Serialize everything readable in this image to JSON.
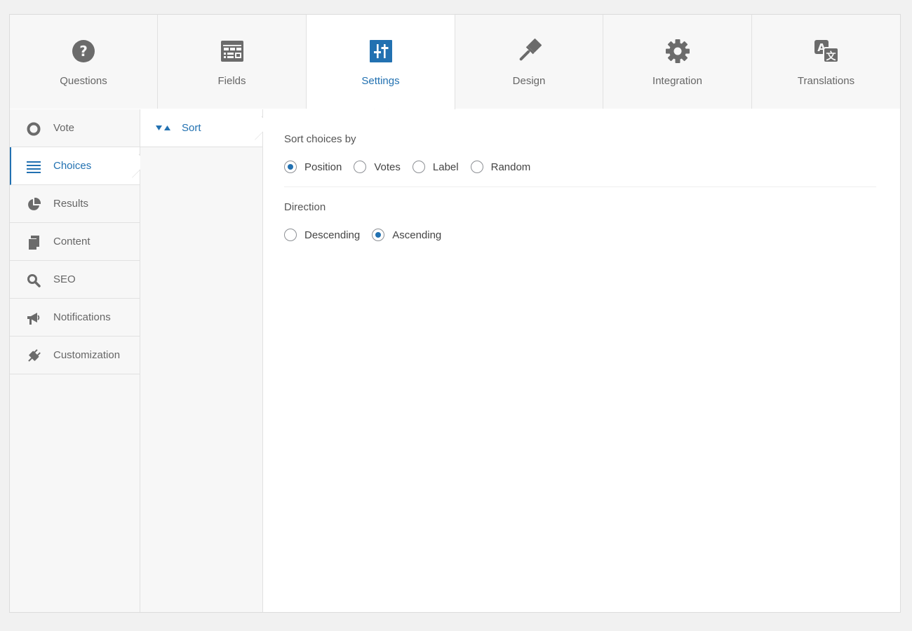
{
  "tabs": [
    {
      "label": "Questions",
      "icon": "question-circle-icon"
    },
    {
      "label": "Fields",
      "icon": "form-fields-icon"
    },
    {
      "label": "Settings",
      "icon": "sliders-icon"
    },
    {
      "label": "Design",
      "icon": "paintbrush-icon"
    },
    {
      "label": "Integration",
      "icon": "gear-icon"
    },
    {
      "label": "Translations",
      "icon": "translation-icon"
    }
  ],
  "active_tab": "Settings",
  "sidebar": {
    "items": [
      {
        "label": "Vote",
        "icon": "circle-icon"
      },
      {
        "label": "Choices",
        "icon": "list-icon"
      },
      {
        "label": "Results",
        "icon": "pie-chart-icon"
      },
      {
        "label": "Content",
        "icon": "pages-icon"
      },
      {
        "label": "SEO",
        "icon": "search-icon"
      },
      {
        "label": "Notifications",
        "icon": "megaphone-icon"
      },
      {
        "label": "Customization",
        "icon": "plugin-icon"
      }
    ],
    "active": "Choices"
  },
  "subnav": {
    "items": [
      {
        "label": "Sort",
        "icon": "sort-icon"
      }
    ]
  },
  "settings": {
    "sort_by": {
      "title": "Sort choices by",
      "options": [
        "Position",
        "Votes",
        "Label",
        "Random"
      ],
      "selected": "Position"
    },
    "direction": {
      "title": "Direction",
      "options": [
        "Descending",
        "Ascending"
      ],
      "selected": "Ascending"
    }
  },
  "colors": {
    "accent": "#2271b1",
    "icon_gray": "#6b6b6b",
    "background": "#f1f1f1"
  }
}
